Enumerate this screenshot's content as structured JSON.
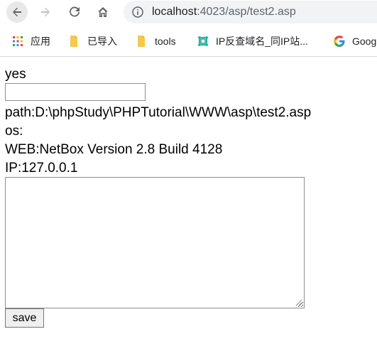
{
  "browser": {
    "url_host": "localhost",
    "url_rest": ":4023/asp/test2.asp",
    "nav": {
      "back": "back",
      "forward": "forward",
      "reload": "reload",
      "home": "home"
    },
    "bookmarks": [
      {
        "label": "应用",
        "icon": "apps-grid-icon"
      },
      {
        "label": "已导入",
        "icon": "folder-icon"
      },
      {
        "label": "tools",
        "icon": "folder-icon"
      },
      {
        "label": "IP反查域名_同IP站...",
        "icon": "site-favicon"
      },
      {
        "label": "Goog",
        "icon": "google-icon"
      }
    ]
  },
  "page": {
    "status_text": "yes",
    "input_value": "",
    "path_line": "path:D:\\phpStudy\\PHPTutorial\\WWW\\asp\\test2.asp",
    "os_line": "os:",
    "web_line": "WEB:NetBox Version 2.8 Build 4128",
    "ip_line": "IP:127.0.0.1",
    "textarea_value": "",
    "save_label": "save"
  },
  "colors": {
    "omnibox_bg": "#f1f3f4",
    "url_host": "#202124",
    "url_rest": "#5f6368",
    "folder": "#f7c948"
  }
}
